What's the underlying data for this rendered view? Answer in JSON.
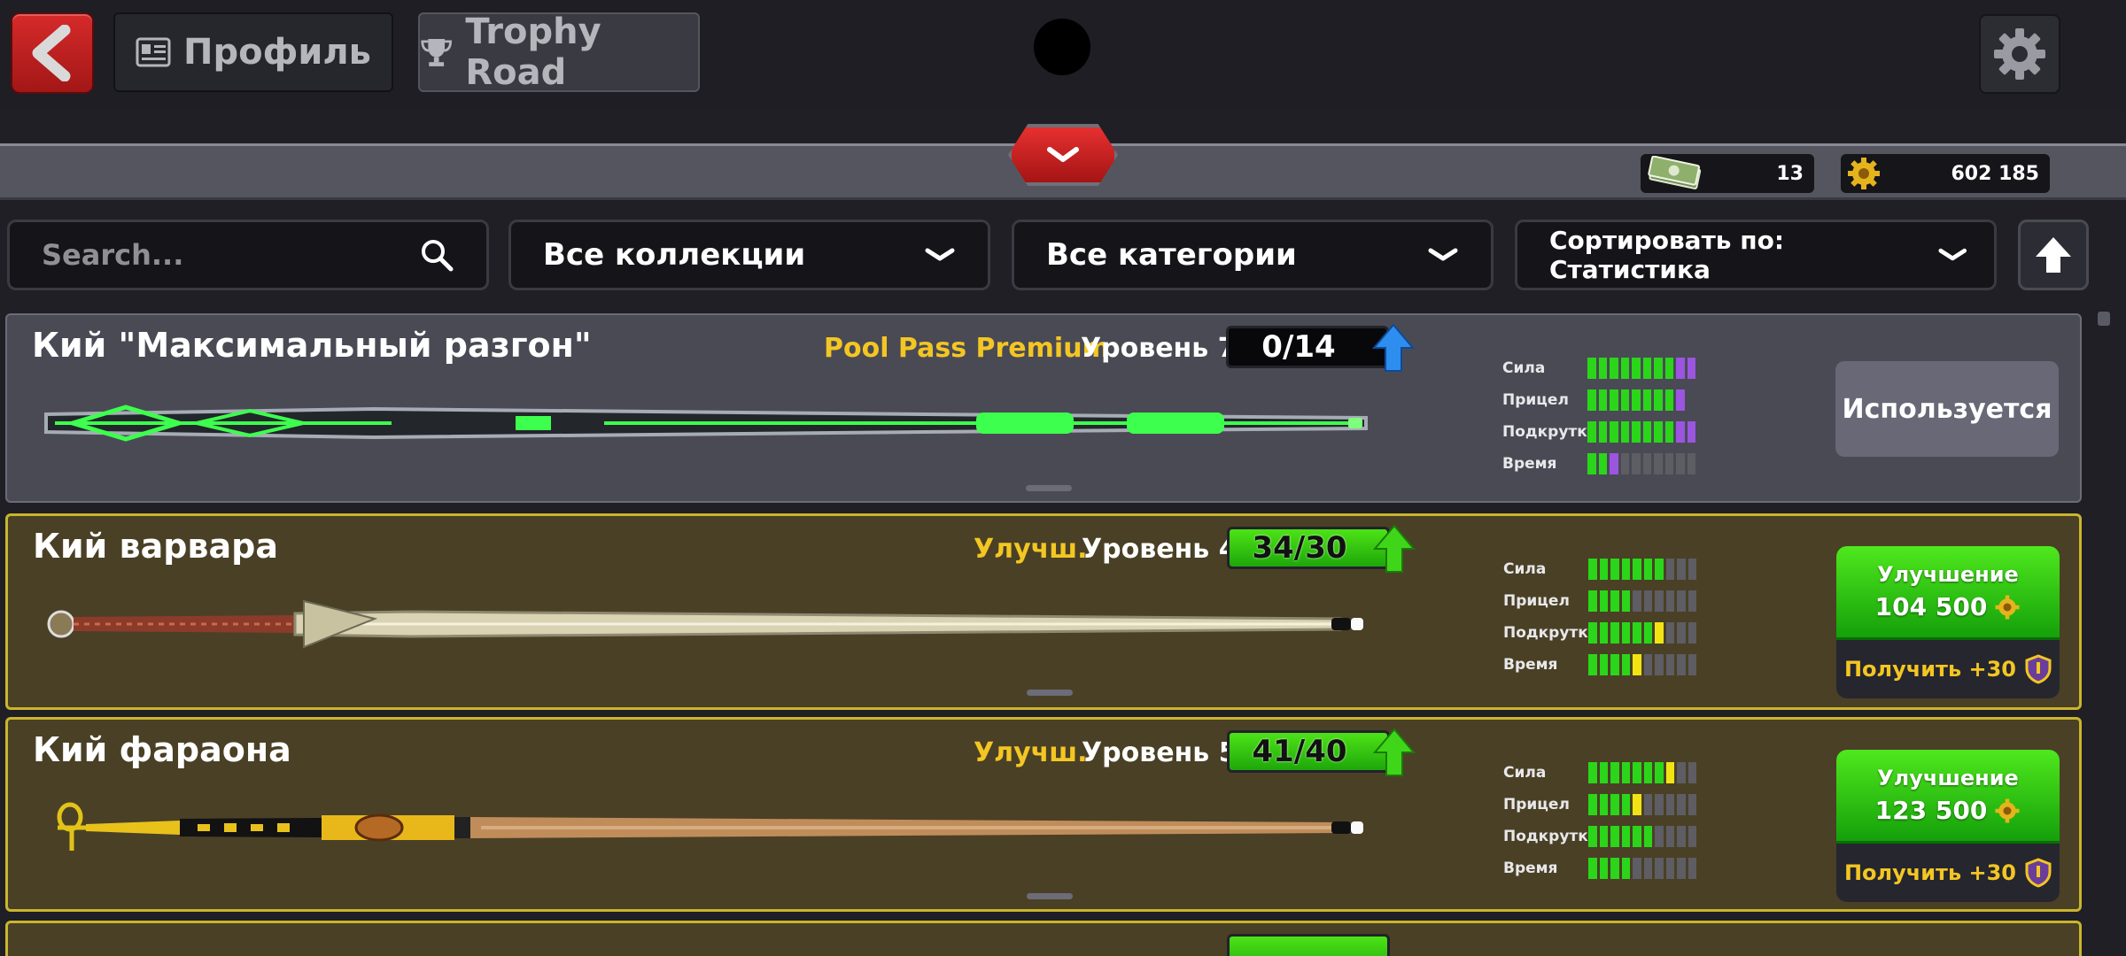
{
  "header": {
    "tab_profile": "Профиль",
    "tab_trophy": "Trophy Road"
  },
  "currency": {
    "cash": "13",
    "coins": "602 185"
  },
  "filters": {
    "search_placeholder": "Search...",
    "collections": "Все коллекции",
    "categories": "Все категории",
    "sort": "Сортировать по: Статистика"
  },
  "stat_labels": [
    "Сила",
    "Прицел",
    "Подкрутка",
    "Время"
  ],
  "cues": [
    {
      "name": "Кий \"Максимальный разгон\"",
      "tag": "Pool Pass Premium",
      "level": "Уровень 7",
      "progress": "0/14",
      "stats": [
        {
          "green": 8,
          "purple": 2,
          "yellow": 0,
          "total": 10
        },
        {
          "green": 8,
          "purple": 1,
          "yellow": 0,
          "total": 9
        },
        {
          "green": 8,
          "purple": 2,
          "yellow": 0,
          "total": 10
        },
        {
          "green": 2,
          "purple": 1,
          "yellow": 0,
          "total": 10
        }
      ],
      "action": "Используется"
    },
    {
      "name": "Кий варвара",
      "tag": "Улучш.",
      "level": "Уровень 4",
      "progress": "34/30",
      "stats": [
        {
          "green": 7,
          "purple": 0,
          "yellow": 0,
          "total": 10
        },
        {
          "green": 4,
          "purple": 0,
          "yellow": 0,
          "total": 10
        },
        {
          "green": 6,
          "purple": 0,
          "yellow": 1,
          "total": 10
        },
        {
          "green": 4,
          "purple": 0,
          "yellow": 1,
          "total": 10
        }
      ],
      "upgrade_label": "Улучшение",
      "upgrade_price": "104 500",
      "get_label": "Получить +30"
    },
    {
      "name": "Кий фараона",
      "tag": "Улучш.",
      "level": "Уровень 5",
      "progress": "41/40",
      "stats": [
        {
          "green": 7,
          "purple": 0,
          "yellow": 1,
          "total": 10
        },
        {
          "green": 4,
          "purple": 0,
          "yellow": 1,
          "total": 10
        },
        {
          "green": 6,
          "purple": 0,
          "yellow": 0,
          "total": 10
        },
        {
          "green": 4,
          "purple": 0,
          "yellow": 0,
          "total": 10
        }
      ],
      "upgrade_label": "Улучшение",
      "upgrade_price": "123 500",
      "get_label": "Получить +30"
    }
  ],
  "icons": [
    "back-arrow-icon",
    "profile-card-icon",
    "trophy-icon",
    "settings-gear-icon",
    "chevron-down-icon",
    "cash-icon",
    "coin-icon",
    "search-icon",
    "up-arrow-icon",
    "shield-icon"
  ]
}
